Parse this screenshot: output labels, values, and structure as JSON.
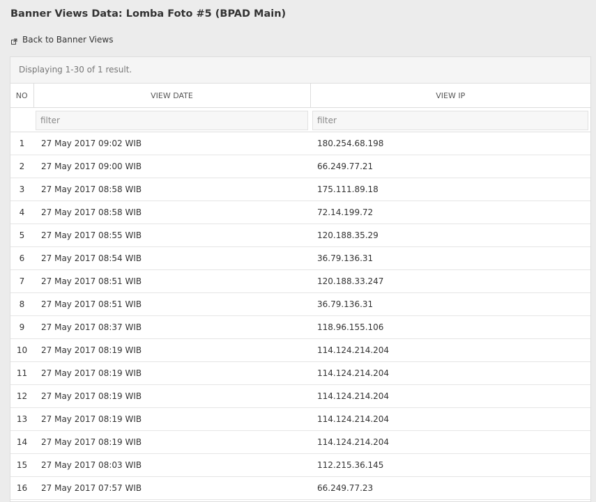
{
  "page": {
    "title": "Banner Views Data: Lomba Foto #5 (BPAD Main)",
    "back_link": "Back to Banner Views"
  },
  "grid": {
    "summary": "Displaying 1-30 of 1 result.",
    "columns": {
      "no": "NO",
      "date": "VIEW DATE",
      "ip": "VIEW IP"
    },
    "filter_placeholder": "filter",
    "rows": [
      {
        "no": "1",
        "date": "27 May 2017 09:02 WIB",
        "ip": "180.254.68.198"
      },
      {
        "no": "2",
        "date": "27 May 2017 09:00 WIB",
        "ip": "66.249.77.21"
      },
      {
        "no": "3",
        "date": "27 May 2017 08:58 WIB",
        "ip": "175.111.89.18"
      },
      {
        "no": "4",
        "date": "27 May 2017 08:58 WIB",
        "ip": "72.14.199.72"
      },
      {
        "no": "5",
        "date": "27 May 2017 08:55 WIB",
        "ip": "120.188.35.29"
      },
      {
        "no": "6",
        "date": "27 May 2017 08:54 WIB",
        "ip": "36.79.136.31"
      },
      {
        "no": "7",
        "date": "27 May 2017 08:51 WIB",
        "ip": "120.188.33.247"
      },
      {
        "no": "8",
        "date": "27 May 2017 08:51 WIB",
        "ip": "36.79.136.31"
      },
      {
        "no": "9",
        "date": "27 May 2017 08:37 WIB",
        "ip": "118.96.155.106"
      },
      {
        "no": "10",
        "date": "27 May 2017 08:19 WIB",
        "ip": "114.124.214.204"
      },
      {
        "no": "11",
        "date": "27 May 2017 08:19 WIB",
        "ip": "114.124.214.204"
      },
      {
        "no": "12",
        "date": "27 May 2017 08:19 WIB",
        "ip": "114.124.214.204"
      },
      {
        "no": "13",
        "date": "27 May 2017 08:19 WIB",
        "ip": "114.124.214.204"
      },
      {
        "no": "14",
        "date": "27 May 2017 08:19 WIB",
        "ip": "114.124.214.204"
      },
      {
        "no": "15",
        "date": "27 May 2017 08:03 WIB",
        "ip": "112.215.36.145"
      },
      {
        "no": "16",
        "date": "27 May 2017 07:57 WIB",
        "ip": "66.249.77.23"
      }
    ]
  },
  "icons": {
    "back": "external-link-icon"
  }
}
